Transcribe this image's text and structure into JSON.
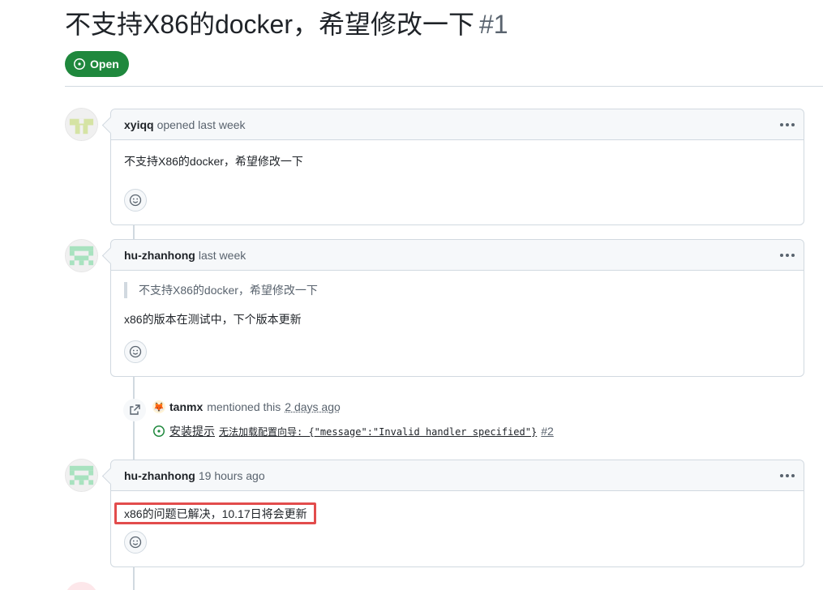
{
  "issue": {
    "title": "不支持X86的docker，希望修改一下",
    "number": "#1",
    "state": "Open",
    "state_color": "#1f883d"
  },
  "comments": [
    {
      "author": "xyiqq",
      "meta": "opened last week",
      "body": "不支持X86的docker，希望修改一下",
      "quote": "",
      "avatar": "identicon-green-yellow"
    },
    {
      "author": "hu-zhanhong",
      "meta": "last week",
      "quote": "不支持X86的docker，希望修改一下",
      "body": "x86的版本在测试中，下个版本更新",
      "avatar": "identicon-green"
    },
    {
      "author": "hu-zhanhong",
      "meta": "19 hours ago",
      "quote": "",
      "body": "x86的问题已解决，10.17日将会更新",
      "avatar": "identicon-green"
    }
  ],
  "mention_event": {
    "actor": "tanmx",
    "action": "mentioned this",
    "time": "2 days ago",
    "ref_title": "安装提示",
    "ref_detail": "无法加载配置向导: {\"message\":\"Invalid handler specified\"}",
    "ref_number": "#2",
    "icon": "cross-reference-icon"
  },
  "colors": {
    "open_green": "#1f883d",
    "highlight_red": "#e24c4c",
    "border": "#d1d9e0",
    "header_bg": "#f6f8fa"
  }
}
